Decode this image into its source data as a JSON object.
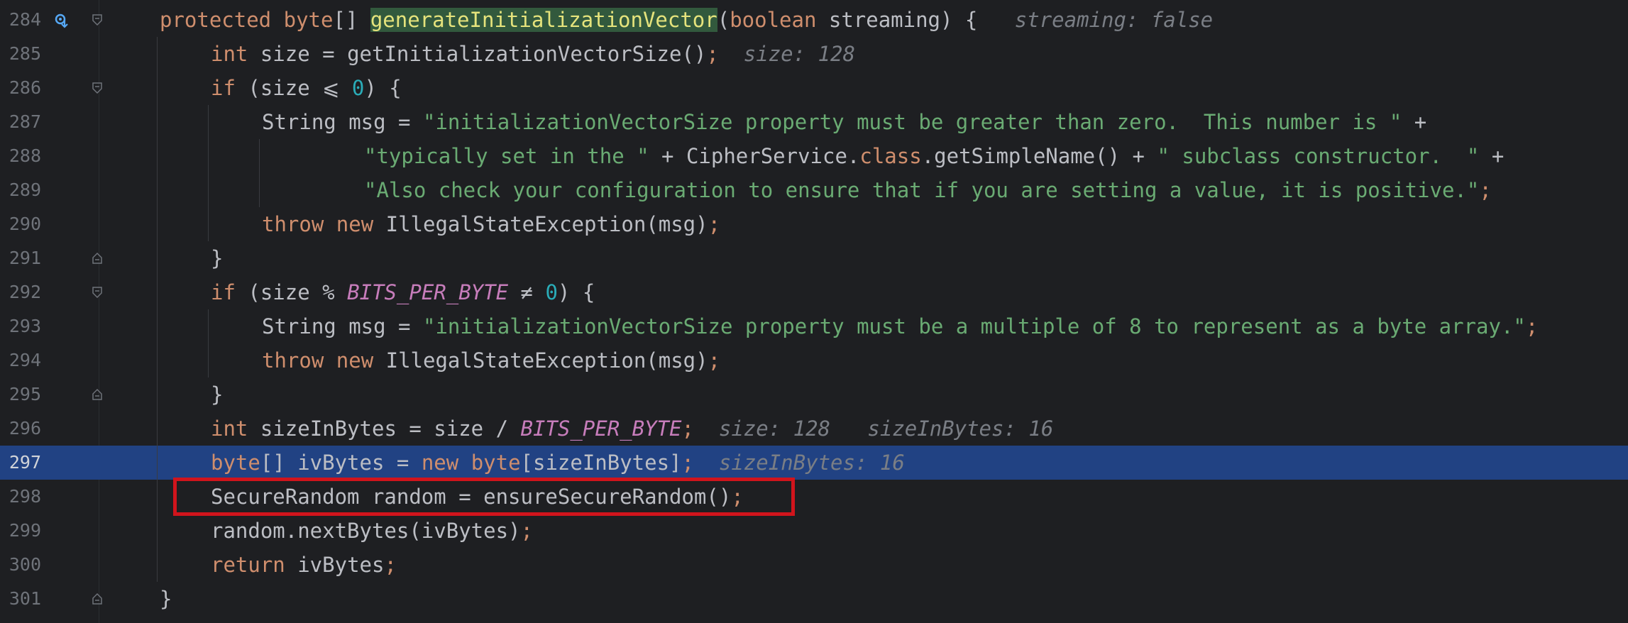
{
  "editor": {
    "lines": [
      {
        "n": "284",
        "hint": "streaming: false"
      },
      {
        "n": "285",
        "hint": "size: 128"
      },
      {
        "n": "286"
      },
      {
        "n": "287"
      },
      {
        "n": "288"
      },
      {
        "n": "289"
      },
      {
        "n": "290"
      },
      {
        "n": "291"
      },
      {
        "n": "292"
      },
      {
        "n": "293"
      },
      {
        "n": "294"
      },
      {
        "n": "295"
      },
      {
        "n": "296",
        "hint1": "size: 128",
        "hint2": "sizeInBytes: 16"
      },
      {
        "n": "297",
        "hint": "sizeInBytes: 16"
      },
      {
        "n": "298"
      },
      {
        "n": "299"
      },
      {
        "n": "300"
      },
      {
        "n": "301"
      }
    ],
    "tokens": {
      "l284": [
        "protected ",
        "byte",
        "[] ",
        "generateInitializationVector",
        "(",
        "boolean",
        " streaming) {"
      ],
      "l285": [
        "int",
        " size = getInitializationVectorSize()",
        ";"
      ],
      "l286": [
        "if",
        " (size ",
        "⩽",
        " ",
        "0",
        ") {"
      ],
      "l287": [
        "String msg = ",
        "\"initializationVectorSize property must be greater than zero.  This number is \"",
        " +"
      ],
      "l288": [
        "\"typically set in the \"",
        " + CipherService.",
        "class",
        ".getSimpleName() + ",
        "\" subclass constructor.  \"",
        " +"
      ],
      "l289": [
        "\"Also check your configuration to ensure that if you are setting a value, it is positive.\"",
        ";"
      ],
      "l290": [
        "throw",
        " ",
        "new",
        " IllegalStateException(msg)",
        ";"
      ],
      "l291": [
        "}"
      ],
      "l292": [
        "if",
        " (size % ",
        "BITS_PER_BYTE",
        " ≠ ",
        "0",
        ") {"
      ],
      "l293": [
        "String msg = ",
        "\"initializationVectorSize property must be a multiple of 8 to represent as a byte array.\"",
        ";"
      ],
      "l294": [
        "throw",
        " ",
        "new",
        " IllegalStateException(msg)",
        ";"
      ],
      "l295": [
        "}"
      ],
      "l296": [
        "int",
        " sizeInBytes = size / ",
        "BITS_PER_BYTE",
        ";"
      ],
      "l297": [
        "byte",
        "[] ivBytes = ",
        "new",
        " ",
        "byte",
        "[sizeInBytes]",
        ";"
      ],
      "l298": [
        "SecureRandom random = ensureSecureRandom()",
        ";"
      ],
      "l299": [
        "random.nextBytes(ivBytes)",
        ";"
      ],
      "l300": [
        "return",
        " ivBytes",
        ";"
      ],
      "l301": [
        "}"
      ]
    }
  },
  "colors": {
    "background": "#1e1f22",
    "current_line": "#214283",
    "keyword": "#cf8e6d",
    "string": "#6aab73",
    "number": "#2aacb8",
    "constant": "#c77dbb",
    "hint": "#7a7e85",
    "highlight_box": "#d1141c"
  }
}
